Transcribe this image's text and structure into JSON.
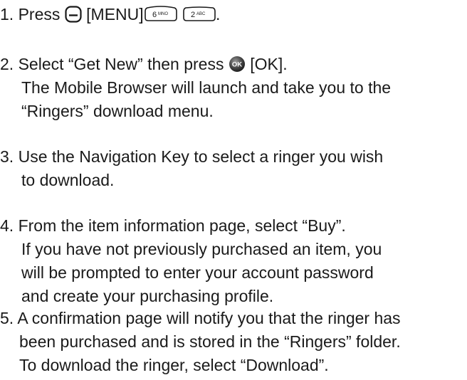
{
  "steps": [
    {
      "number": "1.",
      "pre": "Press",
      "menu_label": "[MENU]",
      "tail": "."
    },
    {
      "number": "2.",
      "line1_pre": "Select “Get New” then press",
      "ok_label": "[OK].",
      "lines": [
        "The Mobile Browser will launch and take you to the",
        "“Ringers” download menu."
      ]
    },
    {
      "number": "3.",
      "lines": [
        "Use the Navigation Key to select a ringer you wish",
        "to download."
      ]
    },
    {
      "number": "4.",
      "lines": [
        "From the item information page, select “Buy”.",
        "If you have not previously purchased an item, you",
        "will be prompted to enter your account password",
        "and create your purchasing profile."
      ]
    },
    {
      "number": "5.",
      "lines": [
        "A confirmation page will notify you that the ringer has",
        "been purchased and is stored in the “Ringers” folder.",
        "To download the ringer, select “Download”."
      ]
    }
  ],
  "icons": {
    "softkey": "left-softkey-icon",
    "key6": "key-6-mno-icon",
    "key2": "key-2-abc-icon",
    "ok": "ok-key-icon",
    "key6_main": "6",
    "key6_sub": "MNO",
    "key2_main": "2",
    "key2_sub": "ABC",
    "ok_text": "OK"
  }
}
